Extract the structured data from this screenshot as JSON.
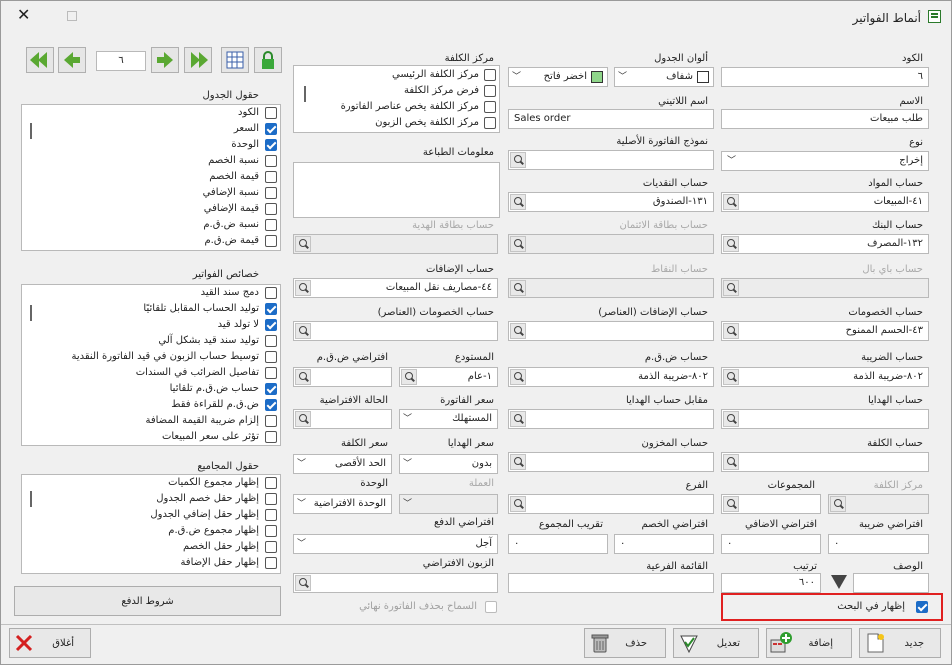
{
  "window": {
    "title": "أنماط الفواتير"
  },
  "code": {
    "label": "الكود",
    "value": "٦"
  },
  "name": {
    "label": "الاسم",
    "value": "طلب مبيعات"
  },
  "type": {
    "label": "نوع",
    "value": "إخراج"
  },
  "materials_account": {
    "label": "حساب المواد",
    "value": "٤١-المبيعات"
  },
  "bank_account": {
    "label": "حساب البنك",
    "value": "١٣٢-المصرف"
  },
  "paypal_account": {
    "label": "حساب باي بال",
    "value": ""
  },
  "discounts_account": {
    "label": "حساب الخصومات",
    "value": "٤٣-الحسم الممنوح"
  },
  "tax_account": {
    "label": "حساب الضريبة",
    "value": "٨٠٢-ضريبة الذمة"
  },
  "gifts_account": {
    "label": "حساب الهدايا",
    "value": ""
  },
  "cost_account": {
    "label": "حساب الكلفة",
    "value": ""
  },
  "cost_center": {
    "label": "مركز الكلفة",
    "value": ""
  },
  "groups": {
    "label": "المجموعات",
    "value": ""
  },
  "default_tax": {
    "label": "افتراضي ضريبة",
    "value": "٠"
  },
  "description": {
    "label": "الوصف",
    "value": ""
  },
  "order": {
    "label": "ترتيب",
    "value": "٦٠٠"
  },
  "show_in_search": {
    "label": "إظهار في البحث",
    "checked": true
  },
  "table_colors": {
    "label": "ألوان الجدول",
    "value1": "شفاف",
    "value2": "اخضر فاتح",
    "swatch2": "#8fd68a"
  },
  "latin_name": {
    "label": "اسم اللاتيني",
    "value": "Sales order"
  },
  "original_invoice_model": {
    "label": "نموذج الفاتورة الأصلية",
    "value": ""
  },
  "cash_account": {
    "label": "حساب النقديات",
    "value": "١٣١-الصندوق"
  },
  "credit_card_account": {
    "label": "حساب بطاقة الائتمان",
    "value": ""
  },
  "points_account": {
    "label": "حساب النقاط",
    "value": ""
  },
  "additions_items_account": {
    "label": "حساب الإضافات (العناصر)",
    "value": ""
  },
  "vat_account": {
    "label": "حساب ض.ق.م",
    "value": "٨٠٢-ضريبة الذمة"
  },
  "gift_counter_account": {
    "label": "مقابل حساب الهدايا",
    "value": ""
  },
  "stock_account": {
    "label": "حساب المخزون",
    "value": ""
  },
  "branch": {
    "label": "الفرع",
    "value": ""
  },
  "default_addition": {
    "label": "افتراضي الاضافي",
    "value": "٠"
  },
  "default_discount": {
    "label": "افتراضي الخصم",
    "value": "٠"
  },
  "total_rounding": {
    "label": "تقريب المجموع",
    "value": "٠"
  },
  "sub_list": {
    "label": "القائمة الفرعية",
    "value": ""
  },
  "cost_centers": {
    "label": "مركز الكلفة",
    "items": [
      {
        "label": "مركز الكلفة الرئيسي",
        "checked": false
      },
      {
        "label": "فرض مركز الكلفة",
        "checked": false
      },
      {
        "label": "مركز الكلفة يخص عناصر الفاتورة",
        "checked": false
      },
      {
        "label": "مركز الكلفة يخص الزبون",
        "checked": false
      }
    ]
  },
  "print_info": {
    "label": "معلومات الطباعة",
    "value": ""
  },
  "gift_card_account": {
    "label": "حساب بطاقة الهدية",
    "value": ""
  },
  "additions_account": {
    "label": "حساب الإضافات",
    "value": "٤٤-مصاريف نقل المبيعات"
  },
  "discounts_items_account": {
    "label": "حساب الخصومات (العناصر)",
    "value": ""
  },
  "warehouse": {
    "label": "المستودع",
    "value": "١-عام"
  },
  "default_vat": {
    "label": "افتراضي ض.ق.م",
    "value": ""
  },
  "invoice_price": {
    "label": "سعر الفاتورة",
    "value": "المستهلك"
  },
  "default_state": {
    "label": "الحالة الافتراضية",
    "value": ""
  },
  "gifts_price": {
    "label": "سعر الهدايا",
    "value": "بدون"
  },
  "cost_price": {
    "label": "سعر الكلفة",
    "value": "الحد الأقصى"
  },
  "currency": {
    "label": "العملة",
    "value": ""
  },
  "unit": {
    "label": "الوحدة",
    "value": "الوحدة الافتراضية"
  },
  "default_payment": {
    "label": "افتراضي الدفع",
    "value": "آجل"
  },
  "default_customer": {
    "label": "الزبون الافتراضي",
    "value": ""
  },
  "allow_final_delete": {
    "label": "السماح بحذف الفاتورة نهائي",
    "checked": false
  },
  "nav": {
    "page": "٦"
  },
  "table_fields": {
    "label": "حقول الجدول",
    "items": [
      {
        "label": "الكود",
        "checked": false
      },
      {
        "label": "السعر",
        "checked": true
      },
      {
        "label": "الوحدة",
        "checked": true
      },
      {
        "label": "نسبة الخصم",
        "checked": false
      },
      {
        "label": "قيمة الخصم",
        "checked": false
      },
      {
        "label": "نسبة الإضافي",
        "checked": false
      },
      {
        "label": "قيمة الإضافي",
        "checked": false
      },
      {
        "label": "نسبة ض.ق.م",
        "checked": false
      },
      {
        "label": "قيمة ض.ق.م",
        "checked": false
      }
    ]
  },
  "invoice_props": {
    "label": "خصائص الفواتير",
    "items": [
      {
        "label": "دمج سند القيد",
        "checked": false
      },
      {
        "label": "توليد الحساب المقابل تلقائيًا",
        "checked": true
      },
      {
        "label": "لا تولد قيد",
        "checked": true
      },
      {
        "label": "توليد سند قيد بشكل آلي",
        "checked": false
      },
      {
        "label": "توسيط حساب الزبون في قيد الفاتورة النقدية",
        "checked": false
      },
      {
        "label": "تفاصيل الضرائب في السندات",
        "checked": false
      },
      {
        "label": "حساب ض.ق.م تلقائيا",
        "checked": true
      },
      {
        "label": "ض.ق.م للقراءة فقط",
        "checked": true
      },
      {
        "label": "إلزام ضريبة القيمة المضافة",
        "checked": false
      },
      {
        "label": "تؤثر على سعر المبيعات",
        "checked": false
      }
    ]
  },
  "totals_fields": {
    "label": "حقول المجاميع",
    "items": [
      {
        "label": "إظهار مجموع الكميات",
        "checked": false
      },
      {
        "label": "إظهار حقل خصم الجدول",
        "checked": false
      },
      {
        "label": "إظهار حقل إضافي الجدول",
        "checked": false
      },
      {
        "label": "إظهار مجموع ض.ق.م",
        "checked": false
      },
      {
        "label": "إظهار حقل الخصم",
        "checked": false
      },
      {
        "label": "إظهار حقل الإضافة",
        "checked": false
      }
    ]
  },
  "buttons": {
    "payment_terms": "شروط الدفع",
    "new": "جديد",
    "add": "إضافة",
    "edit": "تعديل",
    "delete": "حذف",
    "close": "أغلاق"
  }
}
